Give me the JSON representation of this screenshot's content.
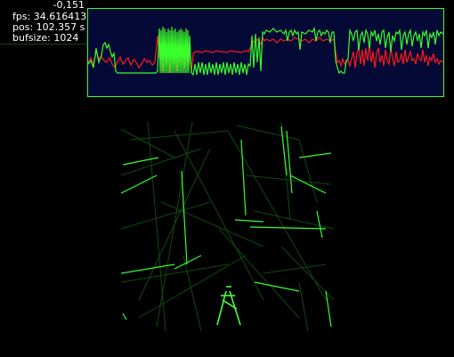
{
  "hud": {
    "coordinate": "-0,151",
    "fps": "fps: 34.616413",
    "pos": "pos: 102.357 s",
    "bufsize": "bufsize: 1024"
  },
  "colors": {
    "background": "#000000",
    "oscilloscope_bg": "#050936",
    "oscilloscope_border": "#35ff35",
    "left_channel": "#39ff2a",
    "right_channel": "#ff1a1a",
    "xy_trace": "#33ff33"
  }
}
